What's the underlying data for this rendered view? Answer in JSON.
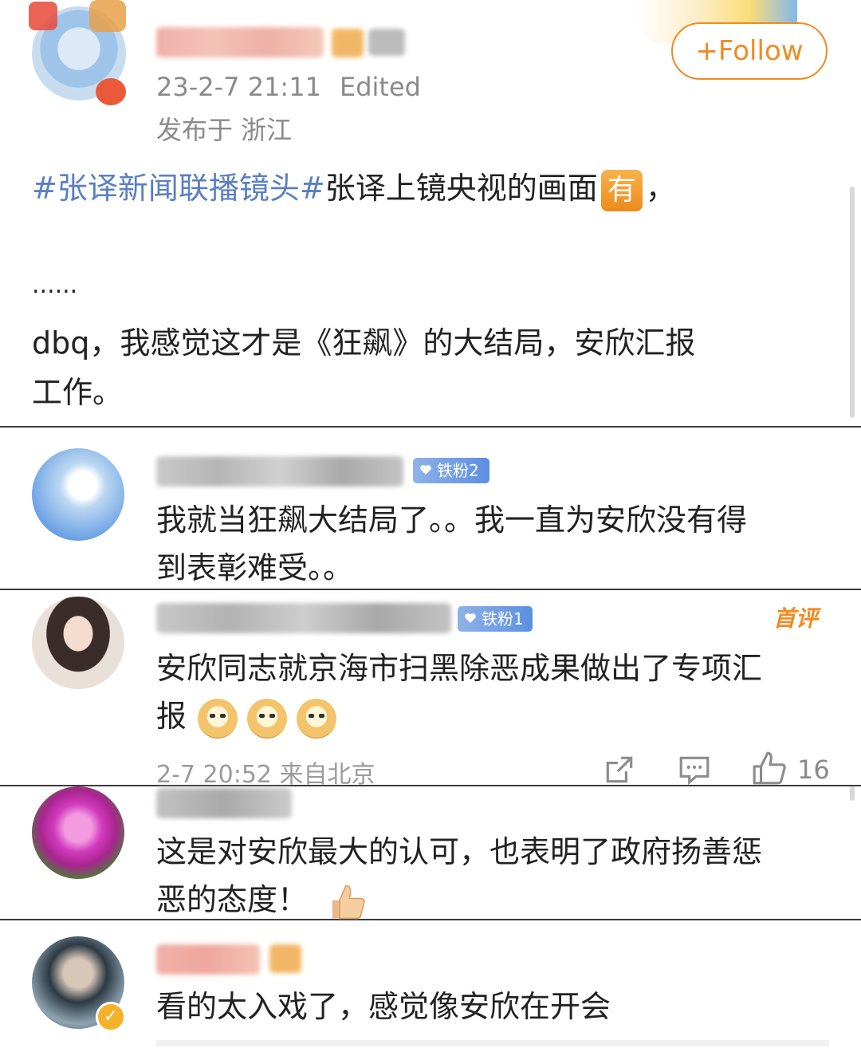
{
  "post": {
    "timestamp": "23-2-7 21:11",
    "edited_label": "Edited",
    "location": "发布于 浙江",
    "follow_label": "+Follow",
    "hashtag": "#张译新闻联播镜头#",
    "text_after_hashtag": "张译上镜央视的画面",
    "badge_char": "有",
    "trailing_comma": "，",
    "ellipsis": "......",
    "body_line1": "dbq，我感觉这才是《狂飙》的大结局，安欣汇报",
    "body_line2": "工作。"
  },
  "comments": [
    {
      "fan_badge": "铁粉2",
      "line1": "我就当狂飙大结局了。。我一直为安欣没有得",
      "line2": "到表彰难受。。"
    },
    {
      "fan_badge": "铁粉1",
      "first_comment_label": "首评",
      "line1": "安欣同志就京海市扫黑除恶成果做出了专项汇",
      "line2": "报",
      "time_location": "2-7 20:52 来自北京",
      "like_count": "16"
    },
    {
      "line1": "这是对安欣最大的认可，也表明了政府扬善惩",
      "line2": "恶的态度！"
    },
    {
      "line1": "看的太入戏了，感觉像安欣在开会"
    }
  ],
  "colors": {
    "hashtag": "#5a7fc2",
    "follow_orange": "#f08b22",
    "meta_gray": "#8a8a8a",
    "fan_blue": "#6b98e2"
  },
  "icons": [
    "share-icon",
    "comment-icon",
    "thumbs-up-icon",
    "thumbs-up-emoji-icon",
    "doge-emoji-icon",
    "verified-icon"
  ]
}
